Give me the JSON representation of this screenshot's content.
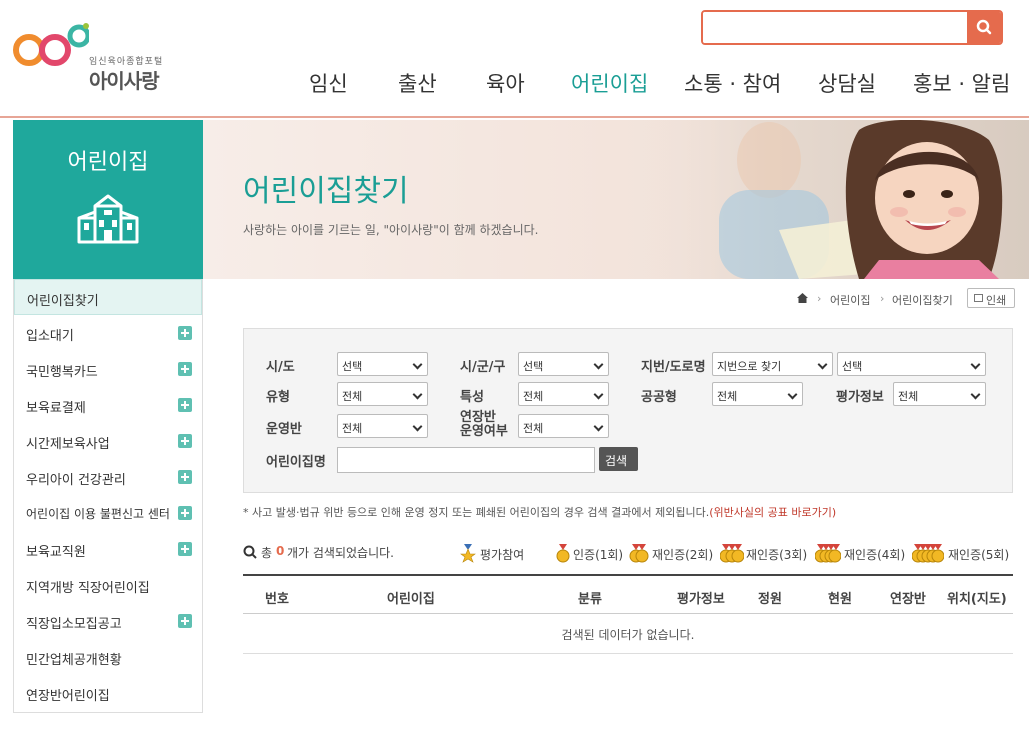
{
  "header": {
    "logo_sub": "임신육아종합포털",
    "logo_name": "아이사랑",
    "search_placeholder": "",
    "nav": [
      "임신",
      "출산",
      "육아",
      "어린이집",
      "소통 · 참여",
      "상담실",
      "홍보 · 알림"
    ],
    "nav_active": "어린이집"
  },
  "sidebar": {
    "title": "어린이집",
    "items": [
      {
        "label": "어린이집찾기",
        "expand": false
      },
      {
        "label": "입소대기",
        "expand": true
      },
      {
        "label": "국민행복카드",
        "expand": true
      },
      {
        "label": "보육료결제",
        "expand": true
      },
      {
        "label": "시간제보육사업",
        "expand": true
      },
      {
        "label": "우리아이 건강관리",
        "expand": true
      },
      {
        "label": "어린이집 이용 불편신고 센터",
        "expand": true
      },
      {
        "label": "보육교직원",
        "expand": true
      },
      {
        "label": "지역개방 직장어린이집",
        "expand": false
      },
      {
        "label": "직장입소모집공고",
        "expand": true
      },
      {
        "label": "민간업체공개현황",
        "expand": false
      },
      {
        "label": "연장반어린이집",
        "expand": false
      }
    ]
  },
  "banner": {
    "title": "어린이집찾기",
    "desc": "사랑하는 아이를 기르는 일, \"아이사랑\"이 함께 하겠습니다."
  },
  "breadcrumb": {
    "items": [
      "어린이집",
      "어린이집찾기"
    ],
    "print_label": "인쇄"
  },
  "form": {
    "sido_label": "시/도",
    "sido_value": "선택",
    "sigungu_label": "시/군/구",
    "sigungu_value": "선택",
    "addr_label": "지번/도로명",
    "addr_type_value": "지번으로 찾기",
    "addr_value": "선택",
    "type_label": "유형",
    "type_value": "전체",
    "feature_label": "특성",
    "feature_value": "전체",
    "public_label": "공공형",
    "public_value": "전체",
    "eval_label": "평가정보",
    "eval_value": "전체",
    "class_label": "운영반",
    "class_value": "전체",
    "ext_label_1": "연장반",
    "ext_label_2": "운영여부",
    "ext_value": "전체",
    "name_label": "어린이집명",
    "name_value": "",
    "search_label": "검색"
  },
  "notice": {
    "text": "* 사고 발생·법규 위반 등으로 인해 운영 정지 또는 폐쇄된 어린이집의 경우 검색 결과에서 제외됩니다.",
    "link": "(위반사실의 공표 바로가기)"
  },
  "summary": {
    "prefix": "총",
    "count": "0",
    "suffix": "개가 검색되었습니다.",
    "legend": [
      "평가참여",
      "인증(1회)",
      "재인증(2회)",
      "재인증(3회)",
      "재인증(4회)",
      "재인증(5회)"
    ]
  },
  "table": {
    "columns": [
      "번호",
      "어린이집",
      "분류",
      "평가정보",
      "정원",
      "현원",
      "연장반",
      "위치(지도)"
    ],
    "empty_text": "검색된 데이터가 없습니다."
  },
  "colors": {
    "accent": "#1fa89c",
    "brand_orange": "#e56b4d"
  }
}
